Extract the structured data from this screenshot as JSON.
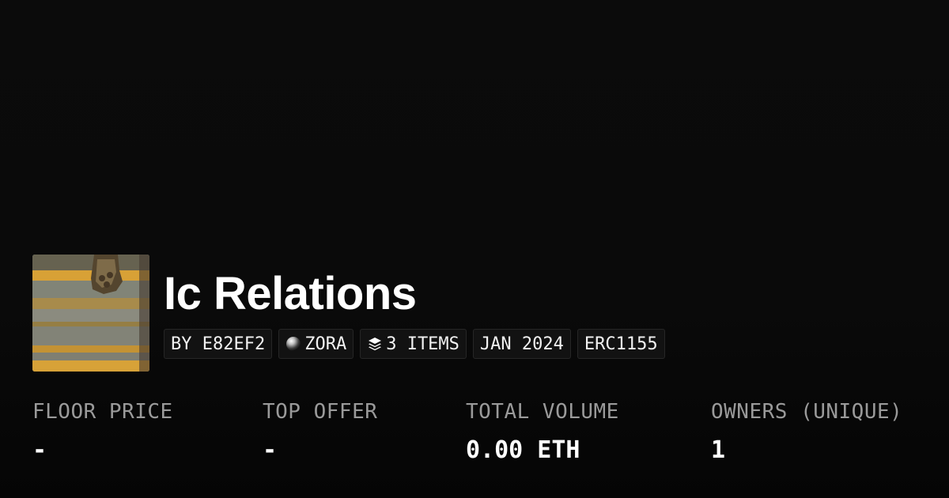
{
  "collection": {
    "title": "Ic Relations",
    "thumbnail_icon": "yellow-striped-steps-image",
    "tags": {
      "creator": "BY E82EF2",
      "network": "ZORA",
      "network_icon": "zora-orb-icon",
      "items": "3 ITEMS",
      "items_icon": "layers-icon",
      "date": "JAN 2024",
      "standard": "ERC1155"
    }
  },
  "stats": [
    {
      "label": "FLOOR PRICE",
      "value": "-"
    },
    {
      "label": "TOP OFFER",
      "value": "-"
    },
    {
      "label": "TOTAL VOLUME",
      "value": "0.00 ETH"
    },
    {
      "label": "OWNERS (UNIQUE)",
      "value": "1"
    }
  ],
  "colors": {
    "background": "#0a0a0a",
    "text": "#ffffff",
    "muted_text": "#9a9a9a",
    "tag_background": "#121212"
  }
}
